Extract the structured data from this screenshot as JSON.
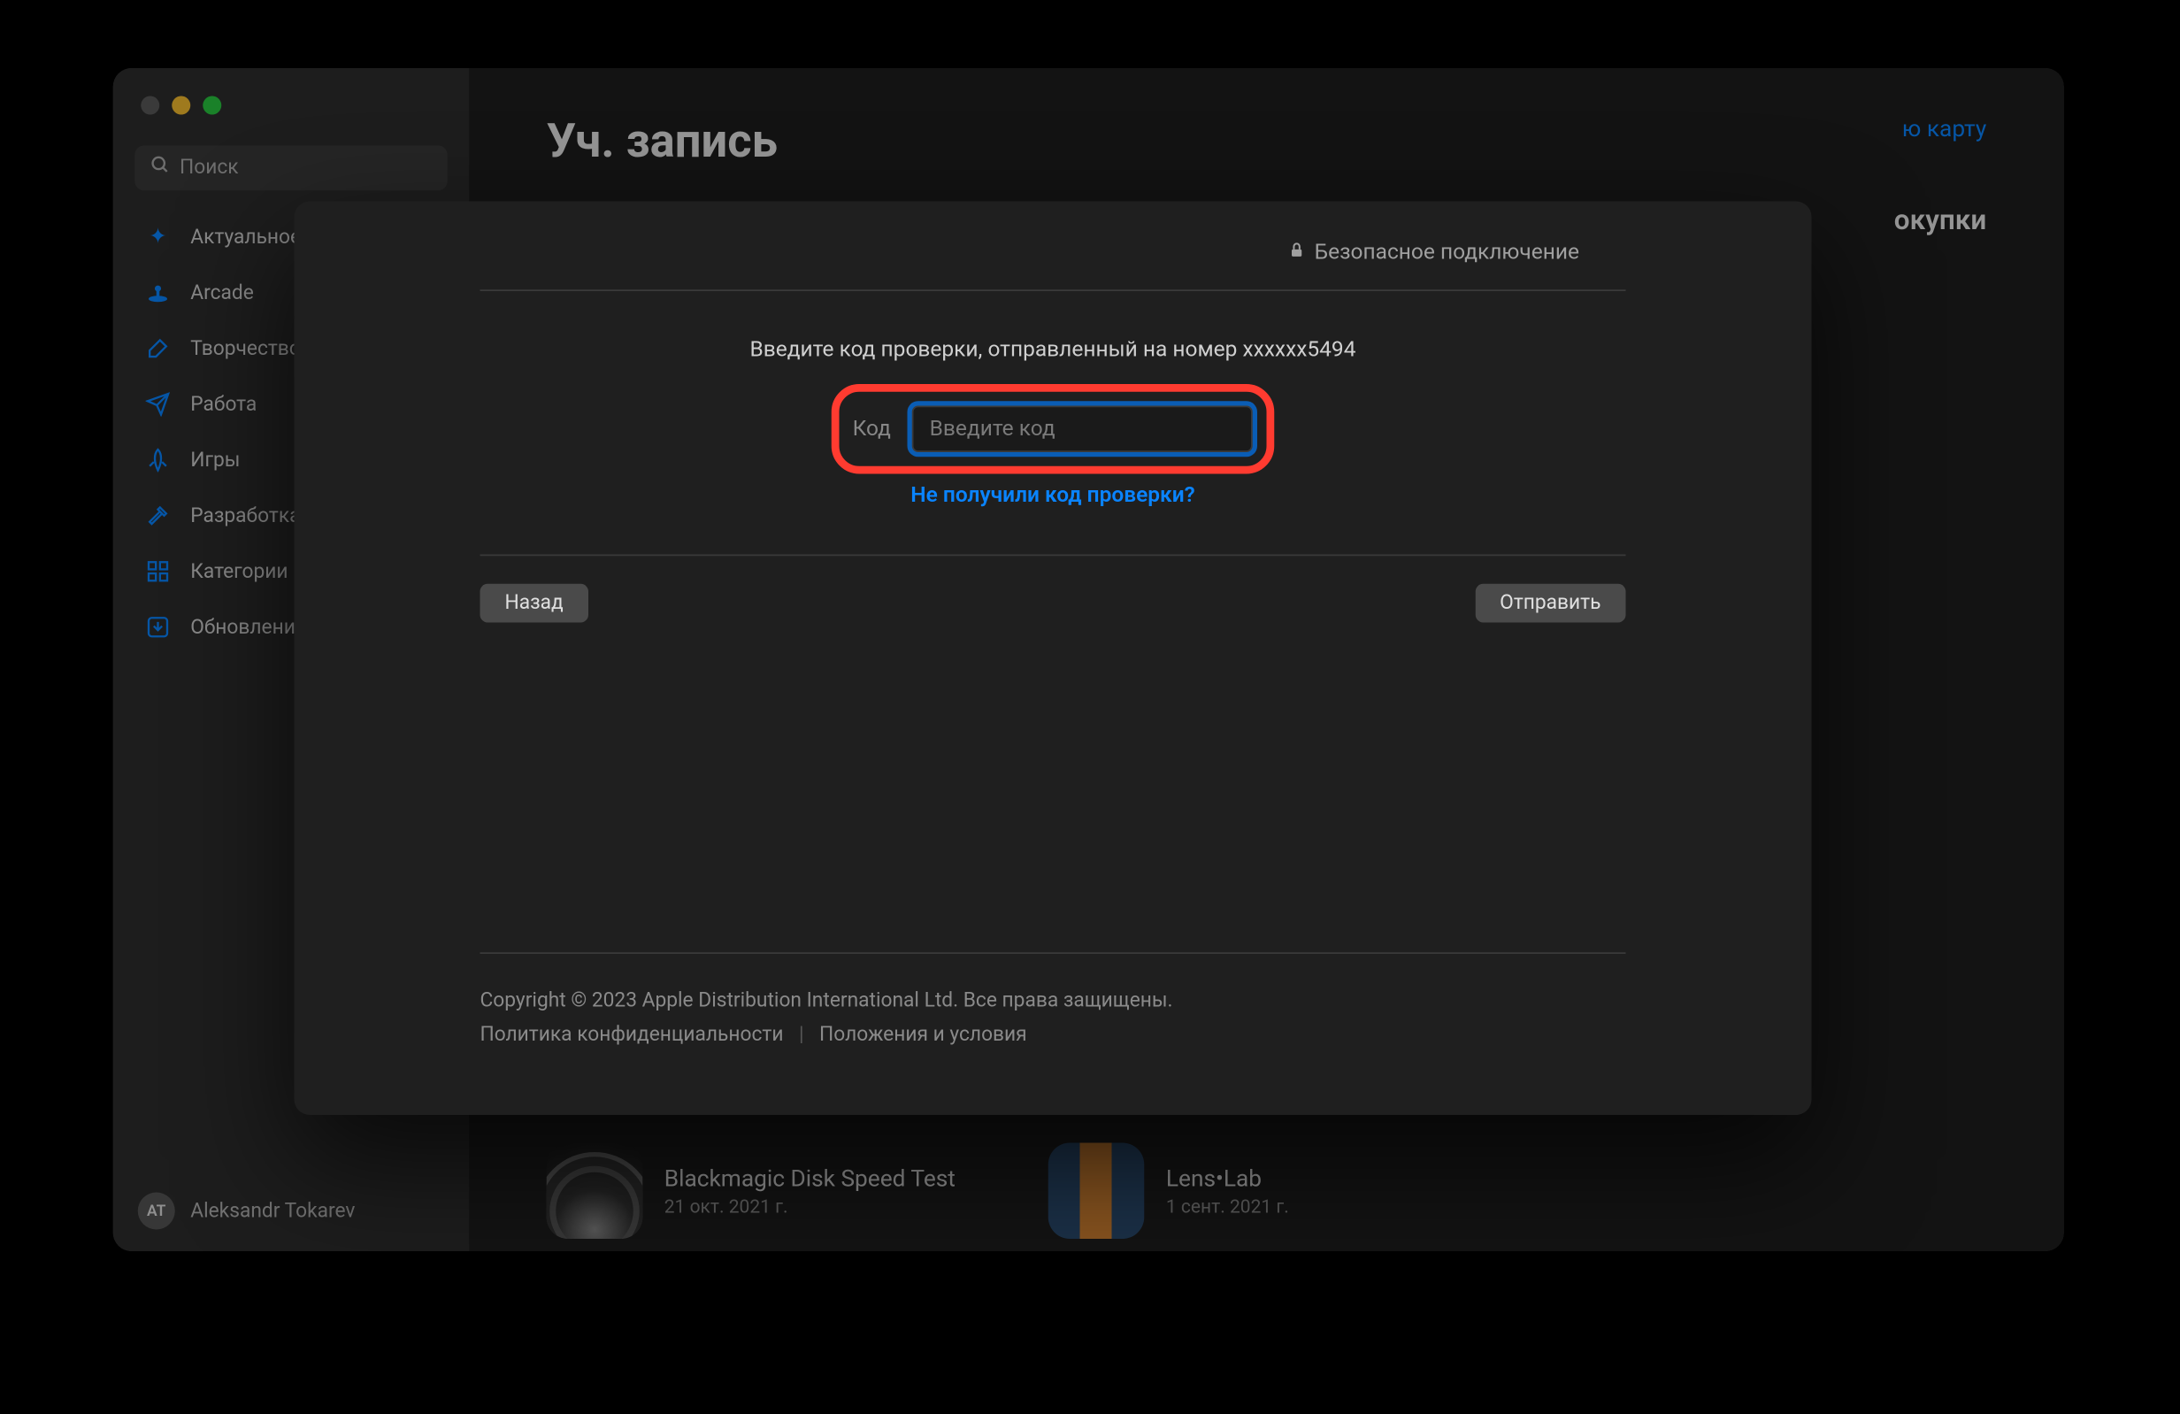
{
  "sidebar": {
    "search_placeholder": "Поиск",
    "items": [
      {
        "icon": "star",
        "label": "Актуальное"
      },
      {
        "icon": "arcade",
        "label": "Arcade"
      },
      {
        "icon": "brush",
        "label": "Творчество"
      },
      {
        "icon": "plane",
        "label": "Работа"
      },
      {
        "icon": "rocket",
        "label": "Игры"
      },
      {
        "icon": "hammer",
        "label": "Разработка"
      },
      {
        "icon": "grid",
        "label": "Категории"
      },
      {
        "icon": "download",
        "label": "Обновления"
      }
    ],
    "user_initials": "AT",
    "user_name": "Aleksandr Tokarev"
  },
  "main": {
    "title_partial": "Уч. запись",
    "header_link_card": "ю карту",
    "section_label_partial": "окупки",
    "apps": [
      {
        "name": "Blackmagic Disk Speed Test",
        "date": "21 окт. 2021 г."
      },
      {
        "name": "Lens•Lab",
        "date": "1 сент. 2021 г."
      }
    ]
  },
  "modal": {
    "secure_label": "Безопасное подключение",
    "instruction": "Введите код проверки, отправленный на номер xxxxxx5494",
    "code_label": "Код",
    "code_placeholder": "Введите код",
    "resend_label": "Не получили код проверки?",
    "back_button": "Назад",
    "submit_button": "Отправить",
    "copyright": "Copyright © 2023 Apple Distribution International Ltd. Все права защищены.",
    "privacy_link": "Политика конфиденциальности",
    "terms_link": "Положения и условия"
  }
}
